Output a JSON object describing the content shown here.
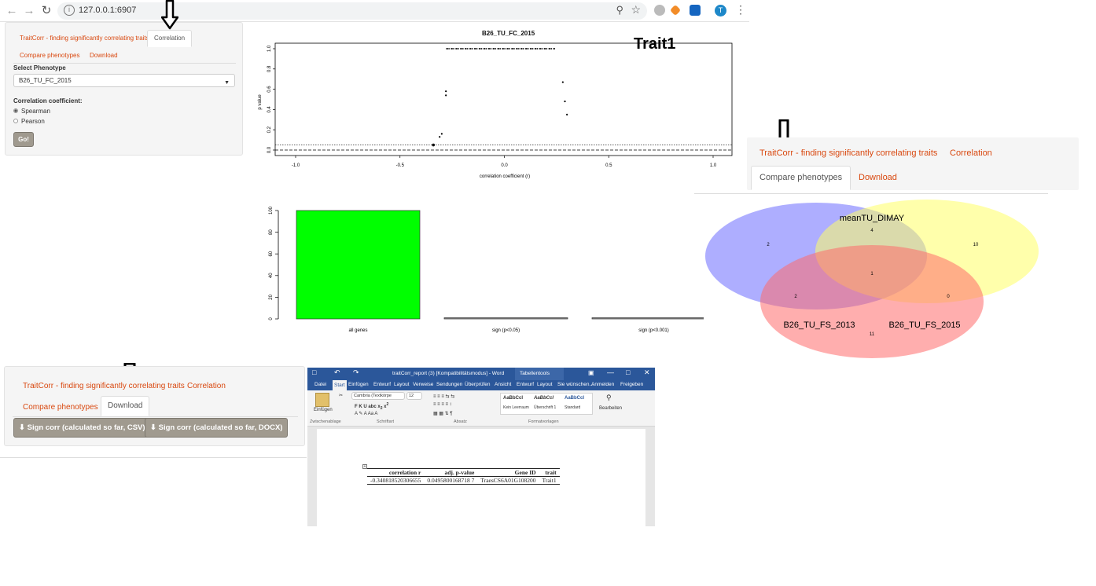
{
  "browser": {
    "url": "127.0.0.1:6907"
  },
  "app": {
    "title_tab": "TraitCorr - finding significantly correlating traits",
    "tab_correlation": "Correlation",
    "tab_compare": "Compare phenotypes",
    "tab_download": "Download"
  },
  "sidebar": {
    "select_label": "Select Phenotype",
    "select_value": "B26_TU_FC_2015",
    "coef_label": "Correlation coefficient:",
    "options": [
      "Spearman",
      "Pearson"
    ],
    "selected_option": "Spearman",
    "go_label": "Go!"
  },
  "volcano": {
    "title": "B26_TU_FC_2015",
    "annotation": "Trait1",
    "xlabel": "correlation coefficient (r)",
    "ylabel": "p value",
    "xticks": [
      "-1.0",
      "-0.5",
      "0.0",
      "0.5",
      "1.0"
    ],
    "yticks": [
      "0.0",
      "0.2",
      "0.4",
      "0.6",
      "0.8",
      "1.0"
    ]
  },
  "barplot": {
    "yticks": [
      "0",
      "20",
      "40",
      "60",
      "80",
      "100"
    ],
    "categories": [
      "all genes",
      "sign (p<0.05)",
      "sign (p<0.001)"
    ]
  },
  "chart_data": [
    {
      "type": "scatter",
      "title": "B26_TU_FC_2015",
      "xlabel": "correlation coefficient (r)",
      "ylabel": "p value",
      "xlim": [
        -1.0,
        1.0
      ],
      "ylim": [
        0.0,
        1.0
      ],
      "points": [
        {
          "x": -0.34,
          "y": 0.05
        },
        {
          "x": -0.31,
          "y": 0.13
        },
        {
          "x": -0.3,
          "y": 0.16
        },
        {
          "x": -0.28,
          "y": 0.54
        },
        {
          "x": -0.28,
          "y": 0.58
        },
        {
          "x": 0.28,
          "y": 0.67
        },
        {
          "x": 0.29,
          "y": 0.48
        },
        {
          "x": 0.3,
          "y": 0.35
        }
      ],
      "dense_band_y": 1.0,
      "dense_band_x_range": [
        -0.28,
        0.24
      ],
      "reference_lines_y": [
        0.05,
        0.0
      ]
    },
    {
      "type": "bar",
      "categories": [
        "all genes",
        "sign (p<0.05)",
        "sign (p<0.001)"
      ],
      "values": [
        100,
        1,
        0
      ],
      "ylim": [
        0,
        100
      ],
      "colors": [
        "#00ff00",
        "#8c8c8c",
        "#8c8c8c"
      ]
    }
  ],
  "venn": {
    "set_labels": [
      "meanTU_DIMAY",
      "B26_TU_FS_2013",
      "B26_TU_FS_2015"
    ],
    "counts": {
      "blue_only": "2",
      "yellow_only": "10",
      "red_only": "11",
      "blue_yellow": "4",
      "blue_red": "2",
      "yellow_red": "0",
      "all": "1"
    },
    "colors": {
      "blue": "#6b6bff",
      "yellow": "#ffff66",
      "red": "#ff6b6b"
    }
  },
  "download": {
    "csv_label": "Sign corr (calculated so far, CSV)",
    "docx_label": "Sign corr (calculated so far, DOCX)"
  },
  "word": {
    "doc_title": "traitCorr_report (3) [Kompatibilitätsmodus] - Word",
    "tools_label": "Tabellentools",
    "menu": [
      "Datei",
      "Start",
      "Einfügen",
      "Entwurf",
      "Layout",
      "Verweise",
      "Sendungen",
      "Überprüfen",
      "Ansicht",
      "Entwurf",
      "Layout",
      "Sie wünschen...",
      "Anmelden",
      "Freigeben"
    ],
    "font_name": "Cambria (Textkörpe",
    "font_size": "12",
    "styles": [
      "AaBbCcI",
      "AaBbCcI",
      "AaBbCcI"
    ],
    "style_names": [
      "Standard",
      "Kein Leerraum",
      "Überschrift 1"
    ],
    "groups": [
      "Zwischenablage",
      "Schriftart",
      "Absatz",
      "Formatvorlagen"
    ],
    "insert_label": "Einfügen",
    "edit_label": "Bearbeiten",
    "table": {
      "headers": [
        "correlation r",
        "adj. p-value",
        "Gene ID",
        "trait"
      ],
      "rows": [
        [
          "-0.340818520306655",
          "0.0495800168718 7",
          "TraesCS6A01G108200",
          "Trait1"
        ]
      ]
    }
  }
}
